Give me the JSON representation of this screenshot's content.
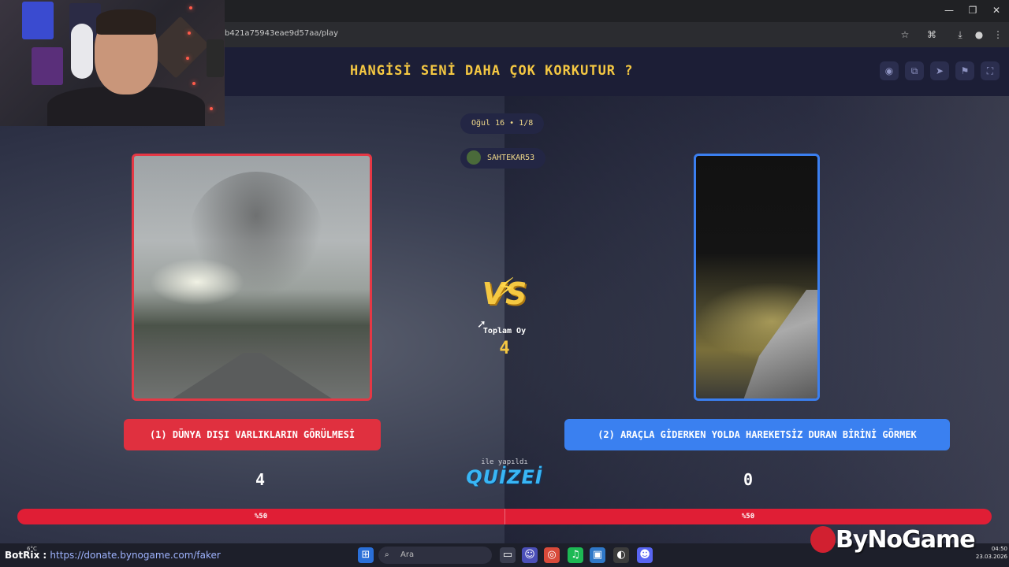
{
  "browser": {
    "url": "b421a75943eae9d57aa/play",
    "window_controls": [
      "—",
      "❐",
      "✕"
    ]
  },
  "quiz": {
    "title": "HANGİSİ SENİ DAHA ÇOK KORKUTUR ?",
    "round": "Oğul 16 • 1/8",
    "creator": "SAHTEKAR53",
    "vs_label": "VS",
    "total_label": "Toplam Oy",
    "total_votes": "4",
    "made_with": "ile yapıldı",
    "brand": "QUİZEİ"
  },
  "options": [
    {
      "label": "(1) DÜNYA DIŞI VARLIKLARIN GÖRÜLMESİ",
      "votes": "4",
      "percent_label": "%50",
      "color": "#e0303f"
    },
    {
      "label": "(2) ARAÇLA GİDERKEN YOLDA HAREKETSİZ DURAN BİRİNİ GÖRMEK",
      "votes": "0",
      "percent_label": "%50",
      "color": "#3a80f0"
    }
  ],
  "progress": {
    "left_fraction": 0.5
  },
  "toolbar_icons": [
    "eye-icon",
    "copy-icon",
    "send-icon",
    "flag-icon",
    "fullscreen-icon"
  ],
  "stream": {
    "donate_prefix": "BotRix :",
    "donate_url": "https://donate.bynogame.com/faker",
    "weather": "6°C",
    "brand_overlay": "ByNoGame"
  },
  "taskbar": {
    "search_placeholder": "Ara",
    "time": "04:50",
    "date": "23.03.2026"
  },
  "colors": {
    "accent_yellow": "#f5c842",
    "red": "#e0303f",
    "blue": "#3a80f0"
  }
}
